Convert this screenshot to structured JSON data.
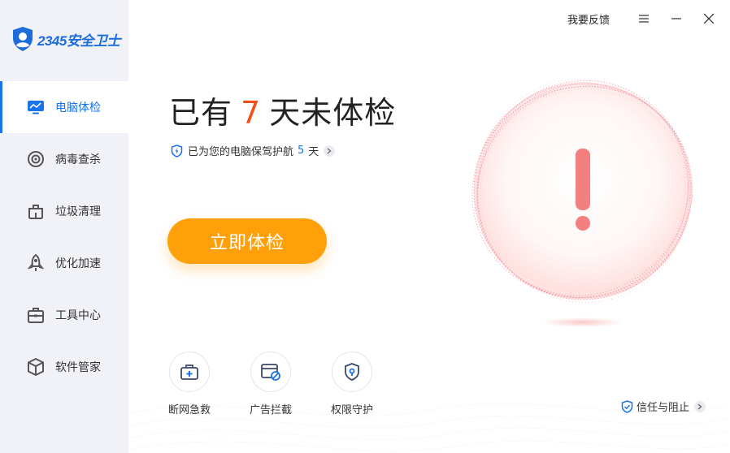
{
  "app": {
    "logo_text": "2345安全卫士"
  },
  "sidebar": {
    "items": [
      {
        "label": "电脑体检",
        "icon": "monitor-icon",
        "active": true
      },
      {
        "label": "病毒查杀",
        "icon": "target-icon",
        "active": false
      },
      {
        "label": "垃圾清理",
        "icon": "trash-icon",
        "active": false
      },
      {
        "label": "优化加速",
        "icon": "rocket-icon",
        "active": false
      },
      {
        "label": "工具中心",
        "icon": "toolbox-icon",
        "active": false
      },
      {
        "label": "软件管家",
        "icon": "box-icon",
        "active": false
      }
    ]
  },
  "topbar": {
    "feedback": "我要反馈"
  },
  "main": {
    "headline_prefix": "已有",
    "headline_days": "7",
    "headline_suffix": "天未体检",
    "sub_prefix": "已为您的电脑保驾护航",
    "sub_days": "5",
    "sub_suffix": "天",
    "scan_button": "立即体检",
    "status_icon": "exclamation-icon"
  },
  "quick_actions": [
    {
      "label": "断网急救",
      "icon": "first-aid-icon"
    },
    {
      "label": "广告拦截",
      "icon": "ad-block-icon"
    },
    {
      "label": "权限守护",
      "icon": "lock-shield-icon"
    }
  ],
  "trust": {
    "label": "信任与阻止"
  },
  "colors": {
    "accent": "#1a73e8",
    "warning": "#f2501b",
    "button": "#ff9f0a",
    "alert": "#f47f7f"
  }
}
